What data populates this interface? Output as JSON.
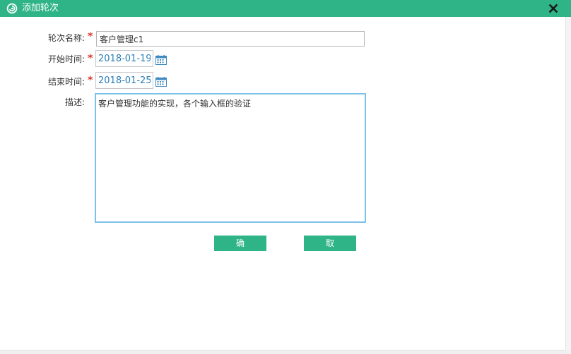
{
  "dialog": {
    "title": "添加轮次",
    "close_icon": "close-icon",
    "logo_icon": "swirl-logo-icon",
    "accent_color": "#2fb488"
  },
  "form": {
    "name": {
      "label": "轮次名称:",
      "required_mark": "*",
      "value": "客户管理c1"
    },
    "start_time": {
      "label": "开始时间:",
      "required_mark": "*",
      "value": "2018-01-19",
      "icon": "calendar-icon"
    },
    "end_time": {
      "label": "结束时间:",
      "required_mark": "*",
      "value": "2018-01-25",
      "icon": "calendar-icon"
    },
    "description": {
      "label": "描述:",
      "value": "客户管理功能的实现，各个输入框的验证"
    }
  },
  "buttons": {
    "confirm": "确定",
    "cancel": "取消"
  }
}
